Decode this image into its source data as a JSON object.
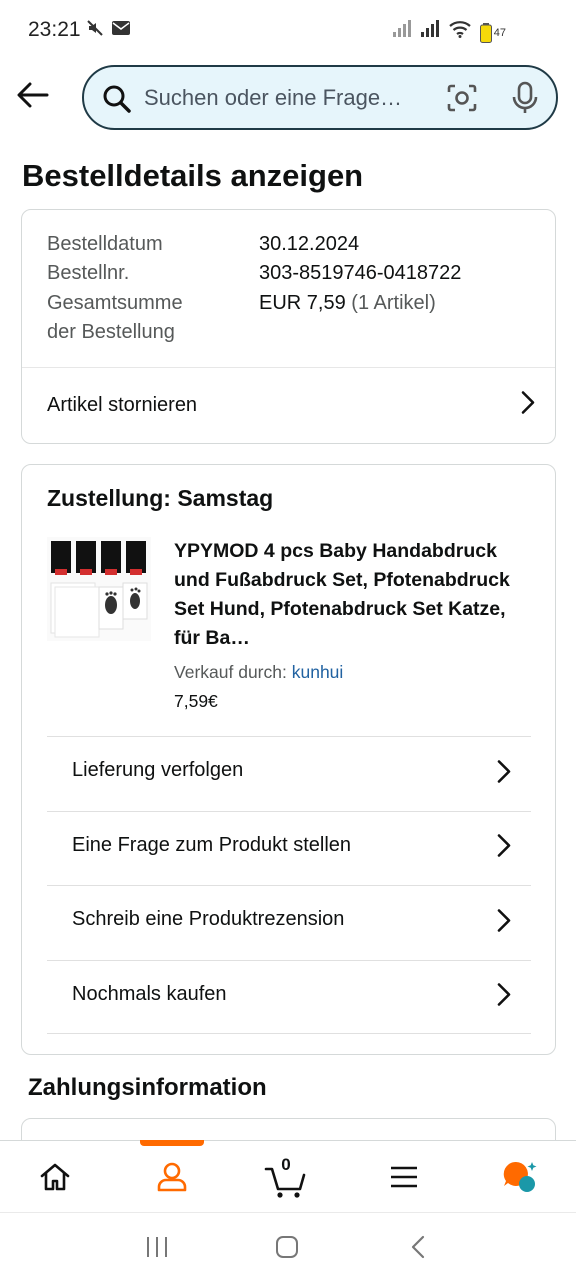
{
  "status_bar": {
    "time": "23:21",
    "battery": "47"
  },
  "search": {
    "placeholder": "Suchen oder eine Frage…"
  },
  "page": {
    "title": "Bestelldetails anzeigen"
  },
  "order_summary": {
    "date_label": "Bestelldatum",
    "date_value": "30.12.2024",
    "number_label": "Bestellnr.",
    "number_value": "303-8519746-0418722",
    "total_label_line1": "Gesamtsumme",
    "total_label_line2": "der Bestellung",
    "total_value": "EUR 7,59",
    "total_items": "(1 Artikel)",
    "cancel_label": "Artikel stornieren"
  },
  "delivery": {
    "title": "Zustellung: Samstag",
    "product": {
      "title": "YPYMOD 4 pcs Baby Handabdruck und Fußabdruck Set, Pfotenabdruck Set Hund, Pfotenabdruck Set Katze, für Ba…",
      "seller_prefix": "Verkauf durch:",
      "seller_name": "kunhui",
      "price": "7,59€"
    },
    "actions": [
      {
        "label": "Lieferung verfolgen"
      },
      {
        "label": "Eine Frage zum Produkt stellen"
      },
      {
        "label": "Schreib eine Produktrezension"
      },
      {
        "label": "Nochmals kaufen"
      }
    ]
  },
  "payment": {
    "heading": "Zahlungsinformation"
  },
  "bottom_nav": {
    "cart_count": "0",
    "active_tab": "account",
    "accent_color": "#ff6a00"
  },
  "colors": {
    "search_border": "#1f3a46",
    "search_bg": "#e6f5fb",
    "link": "#2162a1"
  }
}
